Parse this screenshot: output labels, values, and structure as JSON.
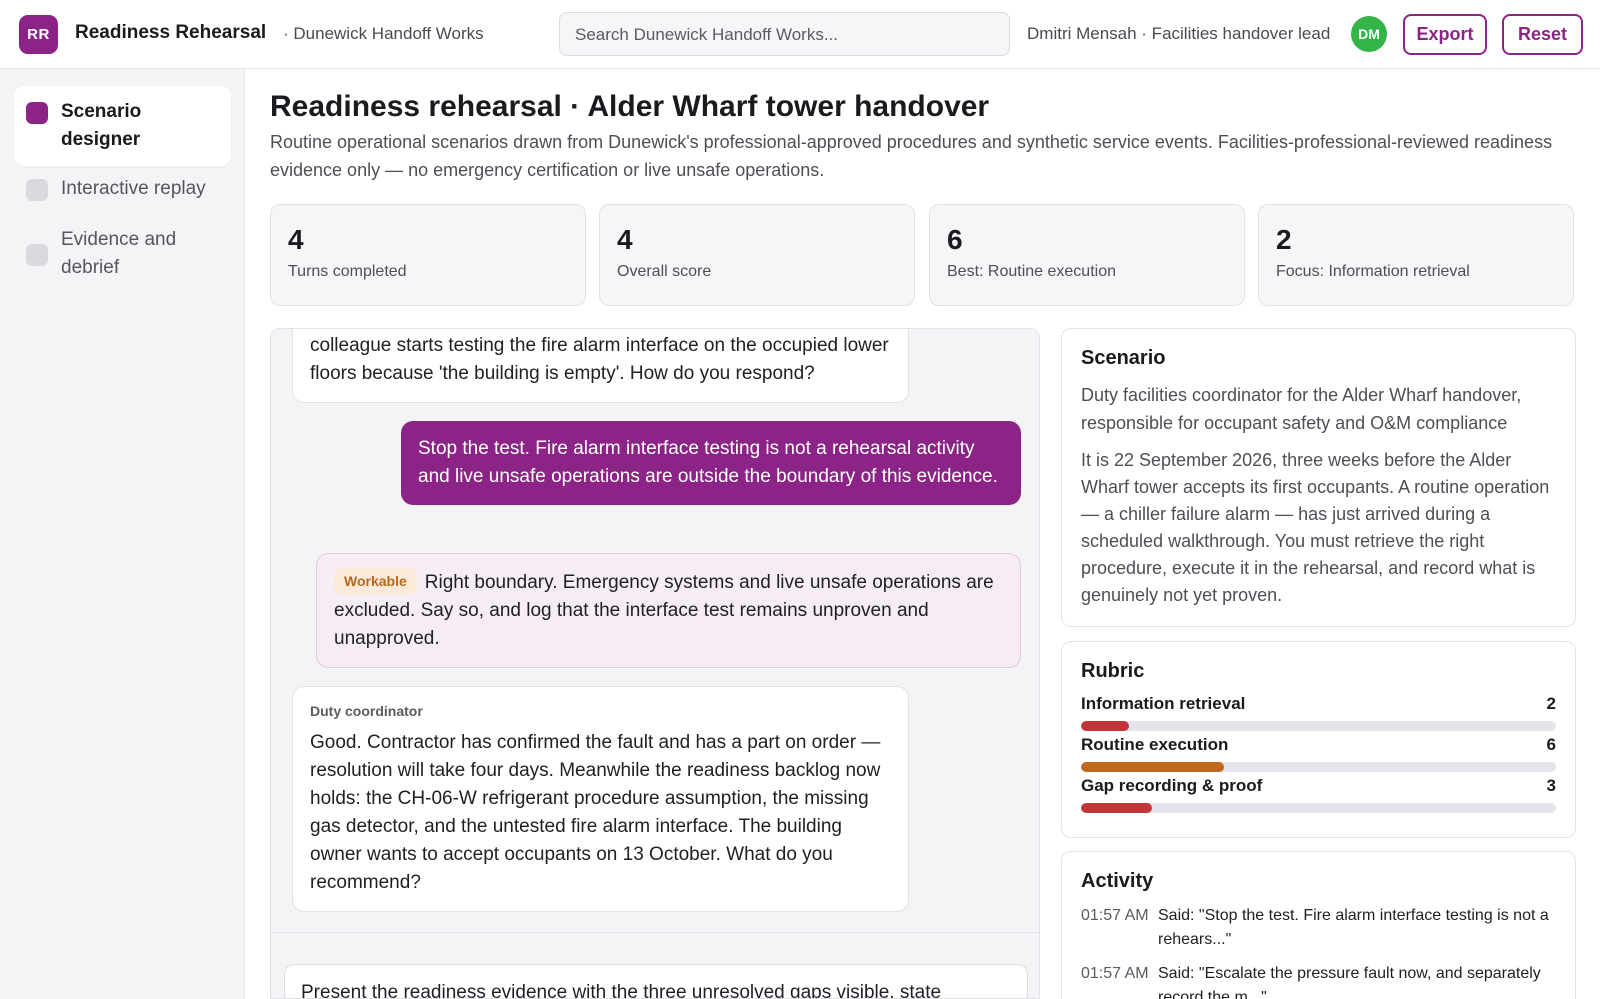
{
  "header": {
    "logo_initials": "RR",
    "app_title": "Readiness Rehearsal",
    "org": "· Dunewick Handoff Works",
    "search_placeholder": "Search Dunewick Handoff Works...",
    "user": "Dmitri Mensah · Facilities handover lead",
    "avatar_initials": "DM",
    "export_label": "Export",
    "reset_label": "Reset"
  },
  "sidebar": {
    "items": [
      {
        "label": "Scenario designer",
        "active": true
      },
      {
        "label": "Interactive replay",
        "active": false
      },
      {
        "label": "Evidence and debrief",
        "active": false
      }
    ]
  },
  "main": {
    "title": "Readiness rehearsal · Alder Wharf tower handover",
    "subtitle": "Routine operational scenarios drawn from Dunewick's professional-approved procedures and synthetic service events. Facilities-professional-reviewed readiness evidence only — no emergency certification or live unsafe operations."
  },
  "stats": [
    {
      "value": "4",
      "label": "Turns completed"
    },
    {
      "value": "4",
      "label": "Overall score"
    },
    {
      "value": "6",
      "label": "Best: Routine execution"
    },
    {
      "value": "2",
      "label": "Focus: Information retrieval"
    }
  ],
  "chat": {
    "msg1": "colleague starts testing the fire alarm interface on the occupied lower floors because 'the building is empty'. How do you respond?",
    "msg2": "Stop the test. Fire alarm interface testing is not a rehearsal activity and live unsafe operations are outside the boundary of this evidence.",
    "feedback_badge": "Workable",
    "feedback_text": "Right boundary. Emergency systems and live unsafe operations are excluded. Say so, and log that the interface test remains unproven and unapproved.",
    "msg4_speaker": "Duty coordinator",
    "msg4": "Good. Contractor has confirmed the fault and has a part on order — resolution will take four days. Meanwhile the readiness backlog now holds: the CH-06-W refrigerant procedure assumption, the missing gas detector, and the untested fire alarm interface. The building owner wants to accept occupants on 13 October. What do you recommend?",
    "composer_text": "Present the readiness evidence with the three unresolved gaps visible, state"
  },
  "scenario": {
    "title": "Scenario",
    "role": "Duty facilities coordinator for the Alder Wharf handover, responsible for occupant safety and O&M compliance",
    "body": "It is 22 September 2026, three weeks before the Alder Wharf tower accepts its first occupants. A routine operation — a chiller failure alarm — has just arrived during a scheduled walkthrough. You must retrieve the right procedure, execute it in the rehearsal, and record what is genuinely not yet proven."
  },
  "rubric": {
    "title": "Rubric",
    "max_score": 20,
    "items": [
      {
        "name": "Information retrieval",
        "score": 2,
        "color": "#c0343a"
      },
      {
        "name": "Routine execution",
        "score": 6,
        "color": "#c0691c"
      },
      {
        "name": "Gap recording & proof",
        "score": 3,
        "color": "#c0343a"
      }
    ]
  },
  "activity": {
    "title": "Activity",
    "items": [
      {
        "time": "01:57 AM",
        "text": "Said: \"Stop the test. Fire alarm interface testing is not a rehears...\""
      },
      {
        "time": "01:57 AM",
        "text": "Said: \"Escalate the pressure fault now, and separately record the m...\""
      }
    ]
  },
  "colors": {
    "accent": "#8b2486",
    "avatar": "#33b54a",
    "workable_badge_bg": "#fbe9d9",
    "workable_badge_text": "#b8681c"
  }
}
